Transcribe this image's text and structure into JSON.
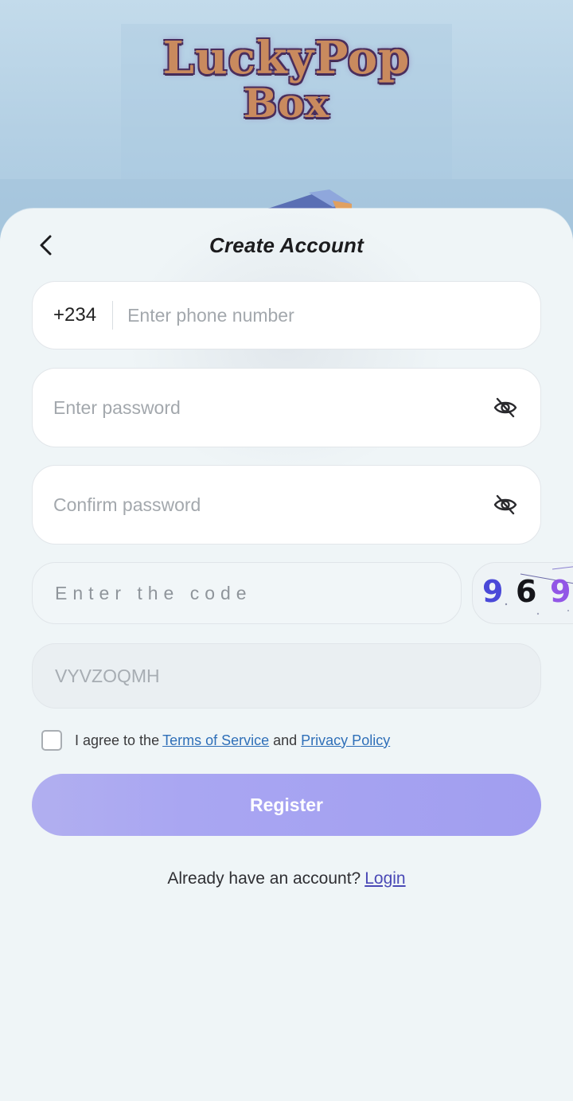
{
  "hero": {
    "logo_line1": "LuckyPop",
    "logo_line2": "Box"
  },
  "header": {
    "back_icon": "chevron-left-icon",
    "title": "Create Account"
  },
  "phone": {
    "country_code": "+234",
    "placeholder": "Enter phone number",
    "value": ""
  },
  "password": {
    "placeholder": "Enter password",
    "value": "",
    "toggle_icon": "eye-off-icon"
  },
  "confirm_password": {
    "placeholder": "Confirm password",
    "value": "",
    "toggle_icon": "eye-off-icon"
  },
  "captcha": {
    "placeholder": "Enter the code",
    "value": "",
    "visible_digits": [
      "9",
      "6",
      "9"
    ]
  },
  "invite_code": {
    "value": "VYVZOQMH"
  },
  "agreement": {
    "checked": false,
    "prefix": "I agree to the",
    "terms_label": "Terms of Service",
    "and_label": "and",
    "privacy_label": "Privacy Policy"
  },
  "register_label": "Register",
  "login_prompt": {
    "text": "Already have an account?",
    "link_label": "Login"
  },
  "colors": {
    "register_bg": "#a19ef0",
    "link": "#2f6fb8",
    "login_link": "#4a49b6",
    "sheet_bg": "#eff5f7"
  }
}
